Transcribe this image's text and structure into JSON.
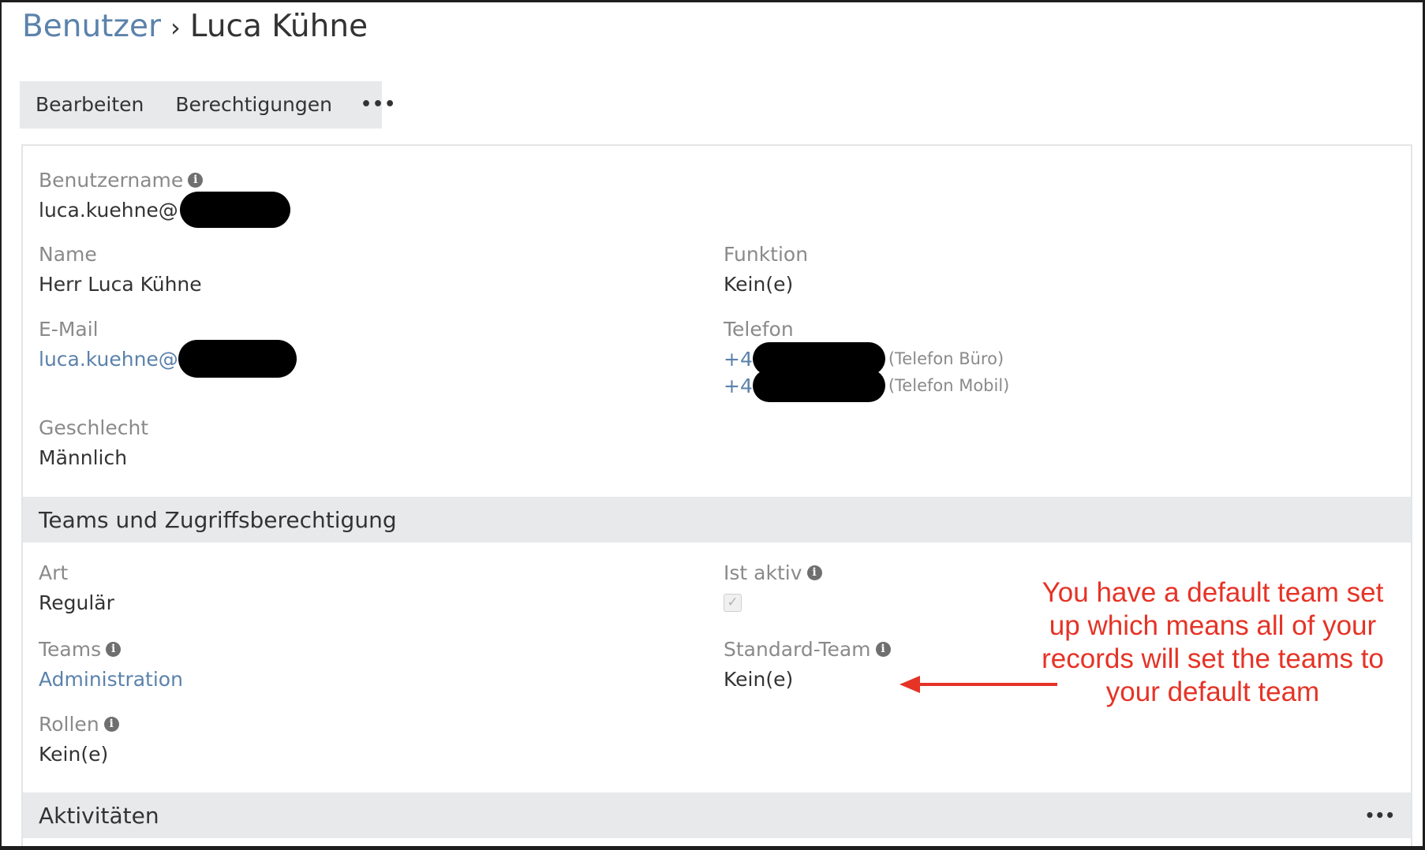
{
  "breadcrumb": {
    "parent": "Benutzer",
    "separator": "›",
    "current": "Luca Kühne"
  },
  "toolbar": {
    "edit_label": "Bearbeiten",
    "permissions_label": "Berechtigungen",
    "more_label": "•••"
  },
  "overview": {
    "username": {
      "label": "Benutzername",
      "value": "luca.kuehne@"
    },
    "name": {
      "label": "Name",
      "value": "Herr Luca Kühne"
    },
    "function": {
      "label": "Funktion",
      "value": "Kein(e)"
    },
    "email": {
      "label": "E-Mail",
      "value": "luca.kuehne@"
    },
    "phone": {
      "label": "Telefon",
      "numbers": [
        {
          "value": "+4",
          "type": "(Telefon Büro)"
        },
        {
          "value": "+4",
          "type": "(Telefon Mobil)"
        }
      ]
    },
    "gender": {
      "label": "Geschlecht",
      "value": "Männlich"
    }
  },
  "teams_section": {
    "title": "Teams und Zugriffsberechtigung",
    "type": {
      "label": "Art",
      "value": "Regulär"
    },
    "is_active": {
      "label": "Ist aktiv",
      "checked": true
    },
    "teams": {
      "label": "Teams",
      "value": "Administration"
    },
    "default_team": {
      "label": "Standard-Team",
      "value": "Kein(e)"
    },
    "roles": {
      "label": "Rollen",
      "value": "Kein(e)"
    }
  },
  "activities_section": {
    "title": "Aktivitäten",
    "more_label": "•••"
  },
  "annotation": {
    "text": "You have a default team set\nup which means all of your\nrecords will set the teams to\nyour default team",
    "color": "#e53326"
  },
  "icons": {
    "info": "info-icon",
    "checkbox": "checkbox-checked-icon",
    "arrow": "arrow-left-icon"
  },
  "colors": {
    "link": "#5b82ab",
    "label": "#8a8a8a",
    "value": "#333333",
    "section_bg": "#e7e9eb"
  }
}
